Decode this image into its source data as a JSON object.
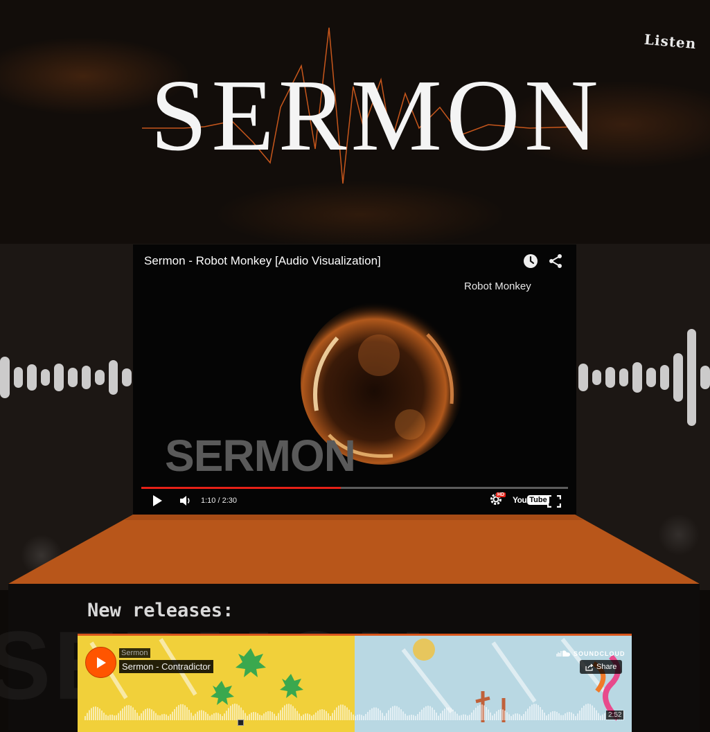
{
  "header": {
    "logo_text": "SERMON",
    "listen_label": "Listen"
  },
  "video": {
    "title": "Sermon - Robot Monkey [Audio Visualization]",
    "subtitle": "Robot Monkey",
    "watermark": "SERMON",
    "time": "1:10 / 2:30",
    "progress_fraction": 0.467,
    "hd_badge": "HD",
    "youtube_you": "You",
    "youtube_tube": "Tube",
    "colors": {
      "progress": "#e62117"
    }
  },
  "stage": {
    "color": "#b8561a"
  },
  "releases": {
    "heading": "New releases:",
    "soundcloud": {
      "artist": "Sermon",
      "track_title": "Sermon - Contradictor",
      "brand": "SOUNDCLOUD",
      "share_label": "Share",
      "duration": "2:52",
      "colors": {
        "accent": "#ff5500"
      }
    }
  },
  "icons": {
    "watch_later": "clock-icon",
    "share": "share-icon",
    "play": "play-icon",
    "volume": "volume-icon",
    "settings": "gear-icon",
    "fullscreen": "fullscreen-icon"
  }
}
